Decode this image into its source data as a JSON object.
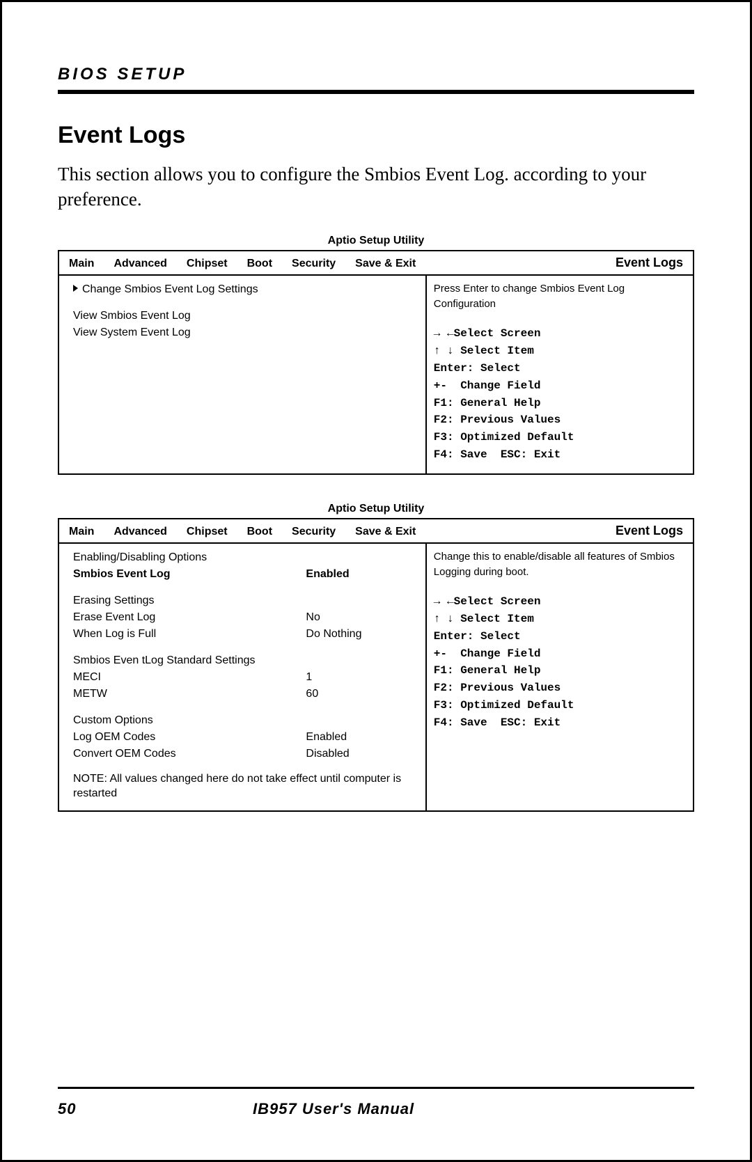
{
  "header": {
    "label": "BIOS SETUP"
  },
  "section": {
    "title": "Event Logs",
    "desc": "This section allows you to configure the Smbios Event Log. according to your preference."
  },
  "bios1": {
    "utilTitle": "Aptio Setup Utility",
    "tabs": {
      "main": "Main",
      "advanced": "Advanced",
      "chipset": "Chipset",
      "boot": "Boot",
      "security": "Security",
      "save": "Save & Exit",
      "active": "Event Logs"
    },
    "left": {
      "i1": "Change Smbios Event Log Settings",
      "i2": "View Smbios Event Log",
      "i3": "View System Event Log"
    },
    "right": {
      "desc": "Press Enter to change Smbios Event Log Configuration",
      "keys": "→ ←Select Screen\n↑ ↓ Select Item\nEnter: Select\n+-  Change Field\nF1: General Help\nF2: Previous Values\nF3: Optimized Default\nF4: Save  ESC: Exit"
    }
  },
  "bios2": {
    "utilTitle": "Aptio Setup Utility",
    "tabs": {
      "main": "Main",
      "advanced": "Advanced",
      "chipset": "Chipset",
      "boot": "Boot",
      "security": "Security",
      "save": "Save & Exit",
      "active": "Event Logs"
    },
    "left": {
      "h1": "Enabling/Disabling Options",
      "r1l": "Smbios Event Log",
      "r1v": "Enabled",
      "h2": "Erasing Settings",
      "r2l": "Erase Event Log",
      "r2v": "No",
      "r3l": "When Log is Full",
      "r3v": "Do Nothing",
      "h3": "Smbios Even tLog Standard Settings",
      "r4l": "MECI",
      "r4v": "1",
      "r5l": "METW",
      "r5v": "60",
      "h4": "Custom Options",
      "r6l": "Log OEM Codes",
      "r6v": "Enabled",
      "r7l": "Convert OEM Codes",
      "r7v": "Disabled",
      "note": "NOTE: All values changed here do not take effect until computer is restarted"
    },
    "right": {
      "desc": "Change this to enable/disable all features of Smbios Logging during boot.",
      "keys": "→ ←Select Screen\n↑ ↓ Select Item\nEnter: Select\n+-  Change Field\nF1: General Help\nF2: Previous Values\nF3: Optimized Default\nF4: Save  ESC: Exit"
    }
  },
  "footer": {
    "page": "50",
    "manual": "IB957 User's Manual"
  }
}
